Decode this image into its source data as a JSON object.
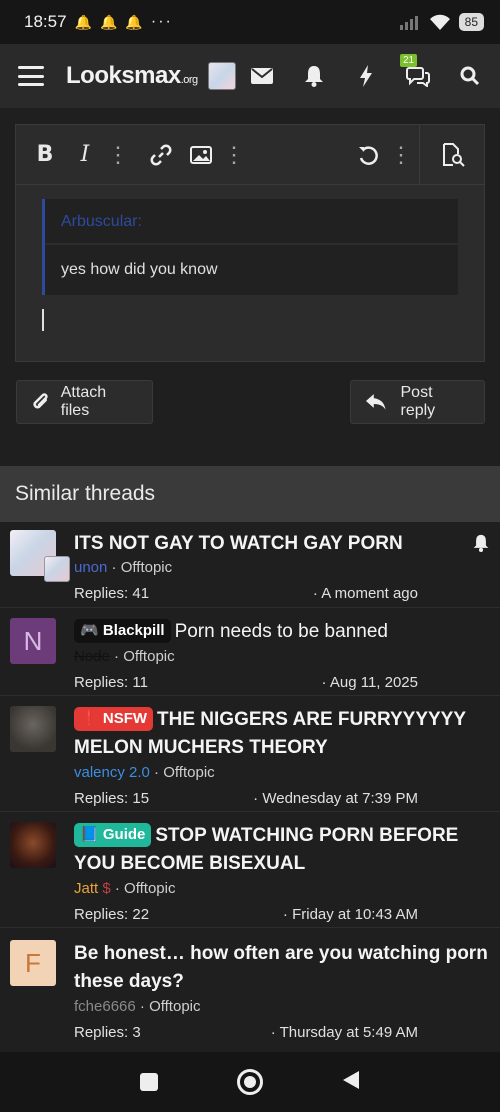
{
  "status_bar": {
    "time": "18:57",
    "battery": "85",
    "dots": "···"
  },
  "nav": {
    "logo_main": "Looksmax",
    "logo_suffix": ".org",
    "notification_count": "21"
  },
  "editor": {
    "quote_author": "Arbuscular:",
    "quote_text": "yes how did you know",
    "attach_label": "Attach files",
    "post_label": "Post reply"
  },
  "similar": {
    "header": "Similar threads",
    "threads": [
      {
        "prefix": "",
        "title": "ITS NOT GAY TO WATCH GAY PORN",
        "author": "unon",
        "forum": "Offtopic",
        "replies": "Replies: 41",
        "date": "A moment ago"
      },
      {
        "prefix": "Blackpill",
        "title": "Porn needs to be banned",
        "author": "Node",
        "forum": "Offtopic",
        "replies": "Replies: 11",
        "date": "Aug 11, 2025"
      },
      {
        "prefix": "NSFW",
        "title": "THE NIGGERS ARE FURRYYYYYY MELON MUCHERS THEORY",
        "author": "valency 2.0",
        "forum": "Offtopic",
        "replies": "Replies: 15",
        "date": "Wednesday at 7:39 PM"
      },
      {
        "prefix": "Guide",
        "title": "STOP WATCHING PORN BEFORE YOU BECOME BISEXUAL",
        "author": "Jatt",
        "forum": "Offtopic",
        "replies": "Replies: 22",
        "date": "Friday at 10:43 AM"
      },
      {
        "prefix": "",
        "title": "Be honest… how often are you watching porn these days?",
        "author": "fche6666",
        "forum": "Offtopic",
        "replies": "Replies: 3",
        "date": "Thursday at 5:49 AM"
      }
    ],
    "avatar_letters": {
      "n": "N",
      "f": "F"
    }
  },
  "colors": {
    "accent_blue": "#2e4a9e",
    "nsfw_red": "#e53935",
    "guide_teal": "#1fb89a",
    "badge_green": "#7cbf2e"
  }
}
